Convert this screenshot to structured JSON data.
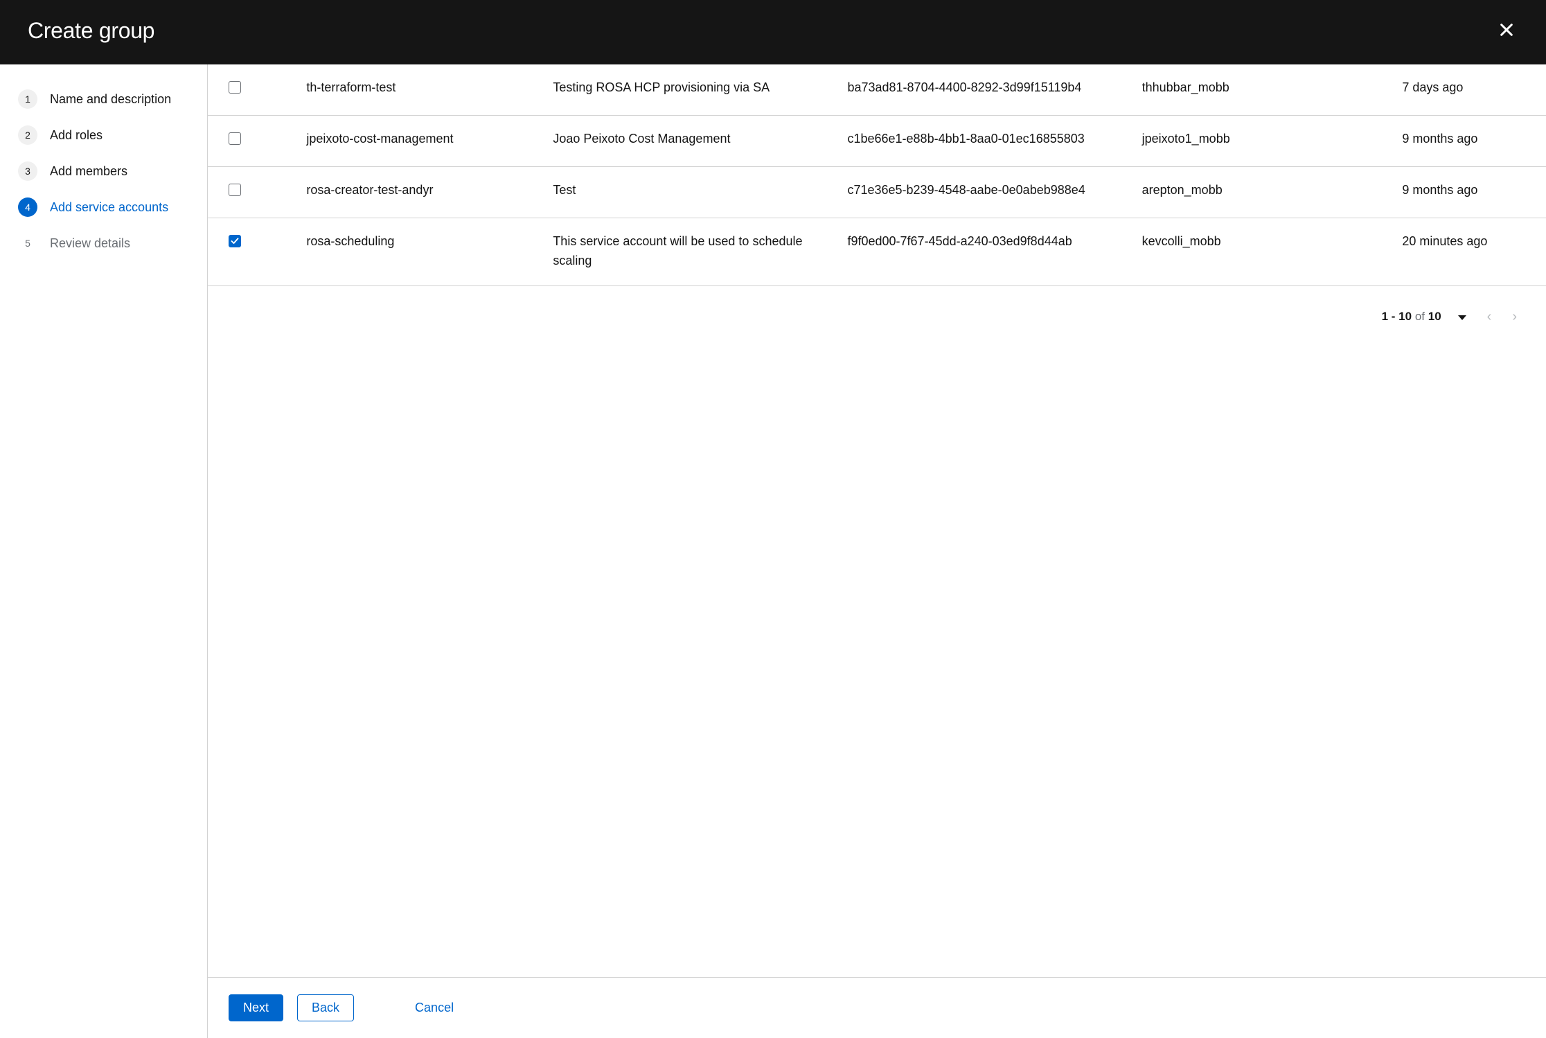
{
  "header": {
    "title": "Create group"
  },
  "sidebar": {
    "steps": [
      {
        "number": "1",
        "label": "Name and description"
      },
      {
        "number": "2",
        "label": "Add roles"
      },
      {
        "number": "3",
        "label": "Add members"
      },
      {
        "number": "4",
        "label": "Add service accounts"
      },
      {
        "number": "5",
        "label": "Review details"
      }
    ]
  },
  "table": {
    "rows": [
      {
        "checked": false,
        "name": "th-terraform-test",
        "description": "Testing ROSA HCP provisioning via SA",
        "client_id": "ba73ad81-8704-4400-8292-3d99f15119b4",
        "owner": "thhubbar_mobb",
        "time": "7 days ago"
      },
      {
        "checked": false,
        "name": "jpeixoto-cost-management",
        "description": "Joao Peixoto Cost Management",
        "client_id": "c1be66e1-e88b-4bb1-8aa0-01ec16855803",
        "owner": "jpeixoto1_mobb",
        "time": "9 months ago"
      },
      {
        "checked": false,
        "name": "rosa-creator-test-andyr",
        "description": "Test",
        "client_id": "c71e36e5-b239-4548-aabe-0e0abeb988e4",
        "owner": "arepton_mobb",
        "time": "9 months ago"
      },
      {
        "checked": true,
        "name": "rosa-scheduling",
        "description": "This service account will be used to schedule scaling",
        "client_id": "f9f0ed00-7f67-45dd-a240-03ed9f8d44ab",
        "owner": "kevcolli_mobb",
        "time": "20 minutes ago"
      }
    ]
  },
  "pagination": {
    "range": "1 - 10",
    "of_text": "of",
    "total": "10"
  },
  "footer": {
    "next": "Next",
    "back": "Back",
    "cancel": "Cancel"
  }
}
